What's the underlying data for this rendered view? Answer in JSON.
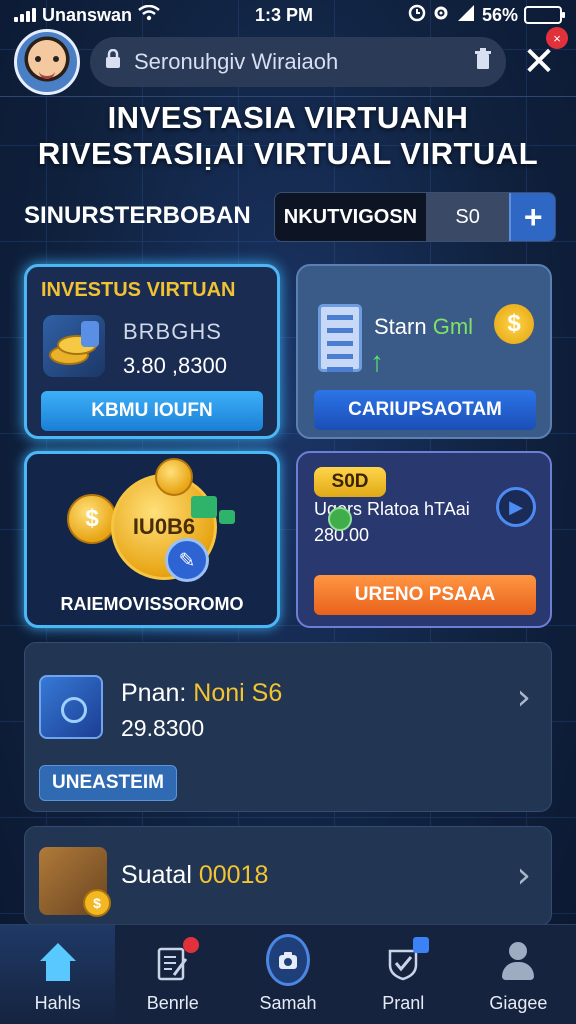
{
  "status_bar": {
    "carrier": "Unanswan",
    "time": "1:3 PM",
    "battery": "56%",
    "battery_level": 0.56
  },
  "header": {
    "search_text": "Seronuhgiv Wiraiaoh",
    "close_badge": "×"
  },
  "titles": {
    "line1": "INVESTASIA VIRTUANH",
    "line2": "RIVESTASIᴉAI VIRTUAL  VIRTUAL"
  },
  "section": {
    "label": "SINURSTERBOBAN",
    "tab_active": "NKUTVIGOSN",
    "tab_other": "S0",
    "add_label": "+"
  },
  "card_a": {
    "title": "INVESTUS VIRTUAN",
    "label": "BRBGHS",
    "value": "3.80 ,8300",
    "button": "KBMU IOUFN"
  },
  "card_b": {
    "stat_prefix": "Starn",
    "stat_value": "Gml",
    "coin_symbol": "$",
    "button": "CARIUPSAOTAM"
  },
  "card_c": {
    "coin_text": "IU0B6",
    "coin_symbol": "$",
    "caption": "RAIEMOVISSOROMO"
  },
  "card_d": {
    "pill": "S0D",
    "info": "Ugers Rlatoa hTAai",
    "amount": "280.00",
    "button": "URENO PSAAA"
  },
  "list_items": [
    {
      "name_prefix": "Pnan:",
      "name_highlight": "Noni S6",
      "amount": "29.8300",
      "button": "UNEASTEIM"
    },
    {
      "name_prefix": "Suatal",
      "name_highlight": "00018",
      "coin_symbol": "$"
    }
  ],
  "bottom_nav": [
    {
      "label": "Hahls",
      "icon": "home-icon"
    },
    {
      "label": "Benrle",
      "icon": "edit-document-icon"
    },
    {
      "label": "Samah",
      "icon": "camera-icon"
    },
    {
      "label": "Pranl",
      "icon": "shield-check-icon"
    },
    {
      "label": "Giagee",
      "icon": "profile-icon"
    }
  ]
}
